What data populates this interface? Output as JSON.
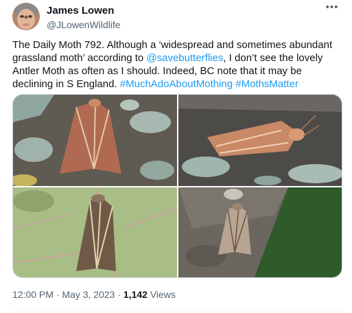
{
  "author": {
    "display_name": "James Lowen",
    "handle": "@JLowenWildlife"
  },
  "more_icon": "more-horizontal-icon",
  "tweet": {
    "text_plain_1": "The Daily Moth 792. Although a ‘widespread and sometimes abundant grassland moth’ according to ",
    "mention": "@savebutterflies",
    "text_plain_2": ", I don’t see the lovely Antler Moth as often as I should. Indeed, BC note that it may be declining in S England. ",
    "hashtag_1": "#MuchAdoAboutMothing",
    "hashtag_2": "#MothsMatter"
  },
  "media": {
    "photos": [
      "antler-moth-on-lichen",
      "antler-moth-on-wood",
      "antler-moth-on-leaf",
      "antler-moth-on-bark"
    ]
  },
  "meta": {
    "time": "12:00 PM",
    "date": "May 3, 2023",
    "views_count": "1,142",
    "views_label": "Views",
    "separator": "·"
  },
  "colors": {
    "link": "#1d9bf0",
    "secondary_text": "#536471",
    "primary_text": "#0f1419"
  }
}
